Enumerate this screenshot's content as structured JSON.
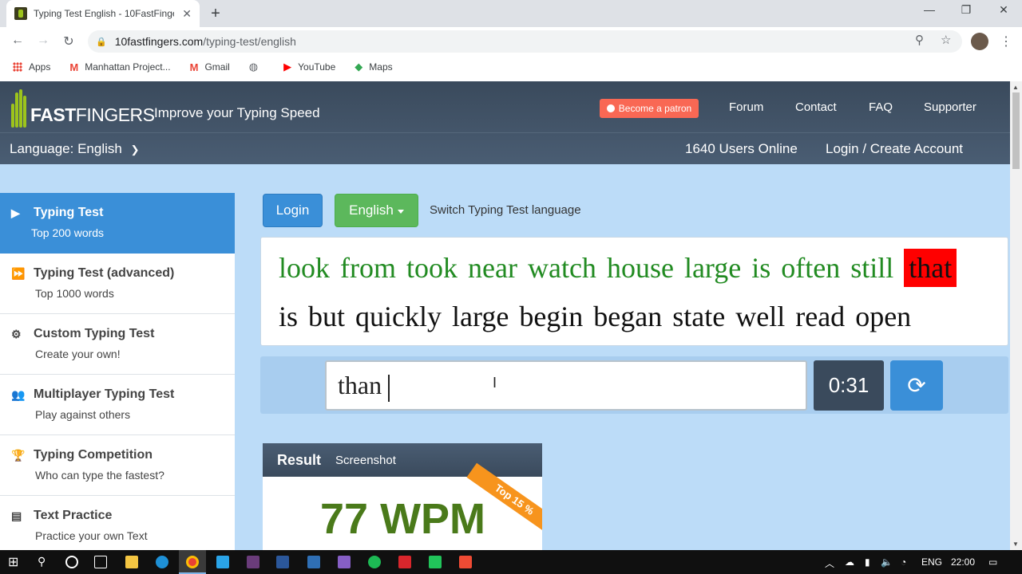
{
  "browser": {
    "tab_title": "Typing Test English - 10FastFingers",
    "tab_close": "✕",
    "new_tab": "+",
    "url_host": "10fastfingers.com",
    "url_path": "/typing-test/english",
    "bookmarks": [
      {
        "label": "Apps",
        "icon": "apps-icon"
      },
      {
        "label": "Manhattan Project...",
        "icon": "gmail-icon"
      },
      {
        "label": "Gmail",
        "icon": "gmail-icon"
      },
      {
        "label": "",
        "icon": "globe-icon"
      },
      {
        "label": "YouTube",
        "icon": "youtube-icon"
      },
      {
        "label": "Maps",
        "icon": "maps-icon"
      }
    ]
  },
  "site": {
    "logo_prefix": "10",
    "logo_bold": "FAST",
    "logo_rest": "FINGERS",
    "tagline": "Improve your Typing Speed",
    "patron": "Become a patron",
    "nav": [
      "Forum",
      "Contact",
      "FAQ",
      "Supporter"
    ],
    "language_selector": "Language: English",
    "users_online": "1640 Users Online",
    "login_create": "Login / Create Account"
  },
  "sidebar": {
    "items": [
      {
        "title": "Typing Test",
        "sub": "Top 200 words",
        "icon": "play-icon",
        "active": true
      },
      {
        "title": "Typing Test (advanced)",
        "sub": "Top 1000 words",
        "icon": "fast-forward-icon"
      },
      {
        "title": "Custom Typing Test",
        "sub": "Create your own!",
        "icon": "gears-icon"
      },
      {
        "title": "Multiplayer Typing Test",
        "sub": "Play against others",
        "icon": "users-icon"
      },
      {
        "title": "Typing Competition",
        "sub": "Who can type the fastest?",
        "icon": "trophy-icon"
      },
      {
        "title": "Text Practice",
        "sub": "Practice your own Text",
        "icon": "document-icon"
      }
    ]
  },
  "main": {
    "login_button": "Login",
    "language_button": "English",
    "switch_language": "Switch Typing Test language",
    "words_line1": {
      "done": [
        "look",
        "from",
        "took",
        "near",
        "watch",
        "house",
        "large",
        "is",
        "often",
        "still"
      ],
      "current": "that"
    },
    "words_line2": [
      "is",
      "but",
      "quickly",
      "large",
      "begin",
      "began",
      "state",
      "well",
      "read",
      "open"
    ],
    "input_value": "than",
    "timer": "0:31",
    "colors": {
      "correct": "#228b22",
      "current_bg": "#ff0000",
      "accent": "#3a8fd8"
    }
  },
  "result": {
    "title": "Result",
    "screenshot": "Screenshot",
    "badge": "Top 15 %",
    "wpm": "77 WPM"
  },
  "taskbar": {
    "language": "ENG",
    "time": "22:00"
  }
}
